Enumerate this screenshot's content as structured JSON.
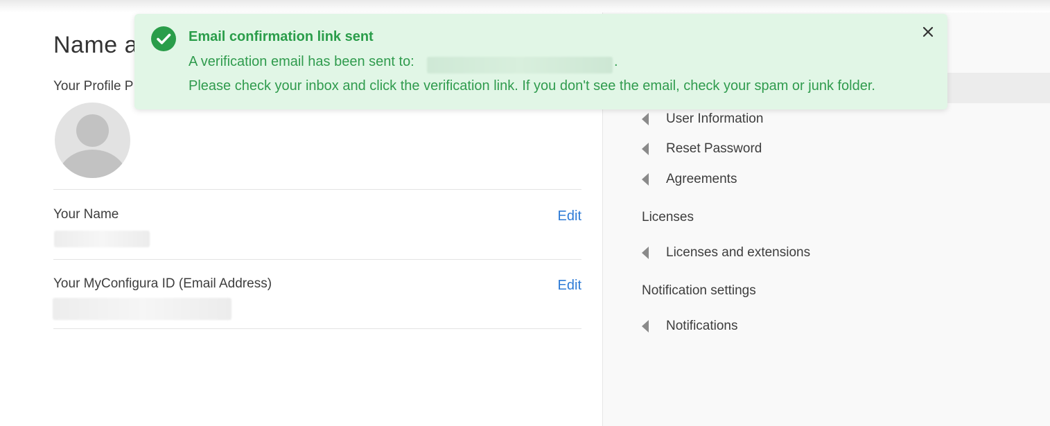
{
  "page": {
    "title": "Name an"
  },
  "profile": {
    "picture_label": "Your Profile P",
    "name_label": "Your Name",
    "name_edit": "Edit",
    "email_label": "Your MyConfigura ID (Email Address)",
    "email_edit": "Edit"
  },
  "sidebar": {
    "items_account": [
      {
        "label": "User Information"
      },
      {
        "label": "Reset Password"
      },
      {
        "label": "Agreements"
      }
    ],
    "section_licenses": "Licenses",
    "items_licenses": [
      {
        "label": "Licenses and extensions"
      }
    ],
    "section_notifications": "Notification settings",
    "items_notifications": [
      {
        "label": "Notifications"
      }
    ]
  },
  "toast": {
    "title": "Email confirmation link sent",
    "line1": "A verification email has been sent to:",
    "line1_end": ".",
    "line2": "Please check your inbox and click the verification link. If you don't see the email, check your spam or junk folder.",
    "icon": "check-circle-icon",
    "close_icon": "close-icon"
  },
  "colors": {
    "success_green": "#2a9d4a",
    "toast_bg": "#e1f6e6",
    "link_blue": "#2e7bd6"
  }
}
